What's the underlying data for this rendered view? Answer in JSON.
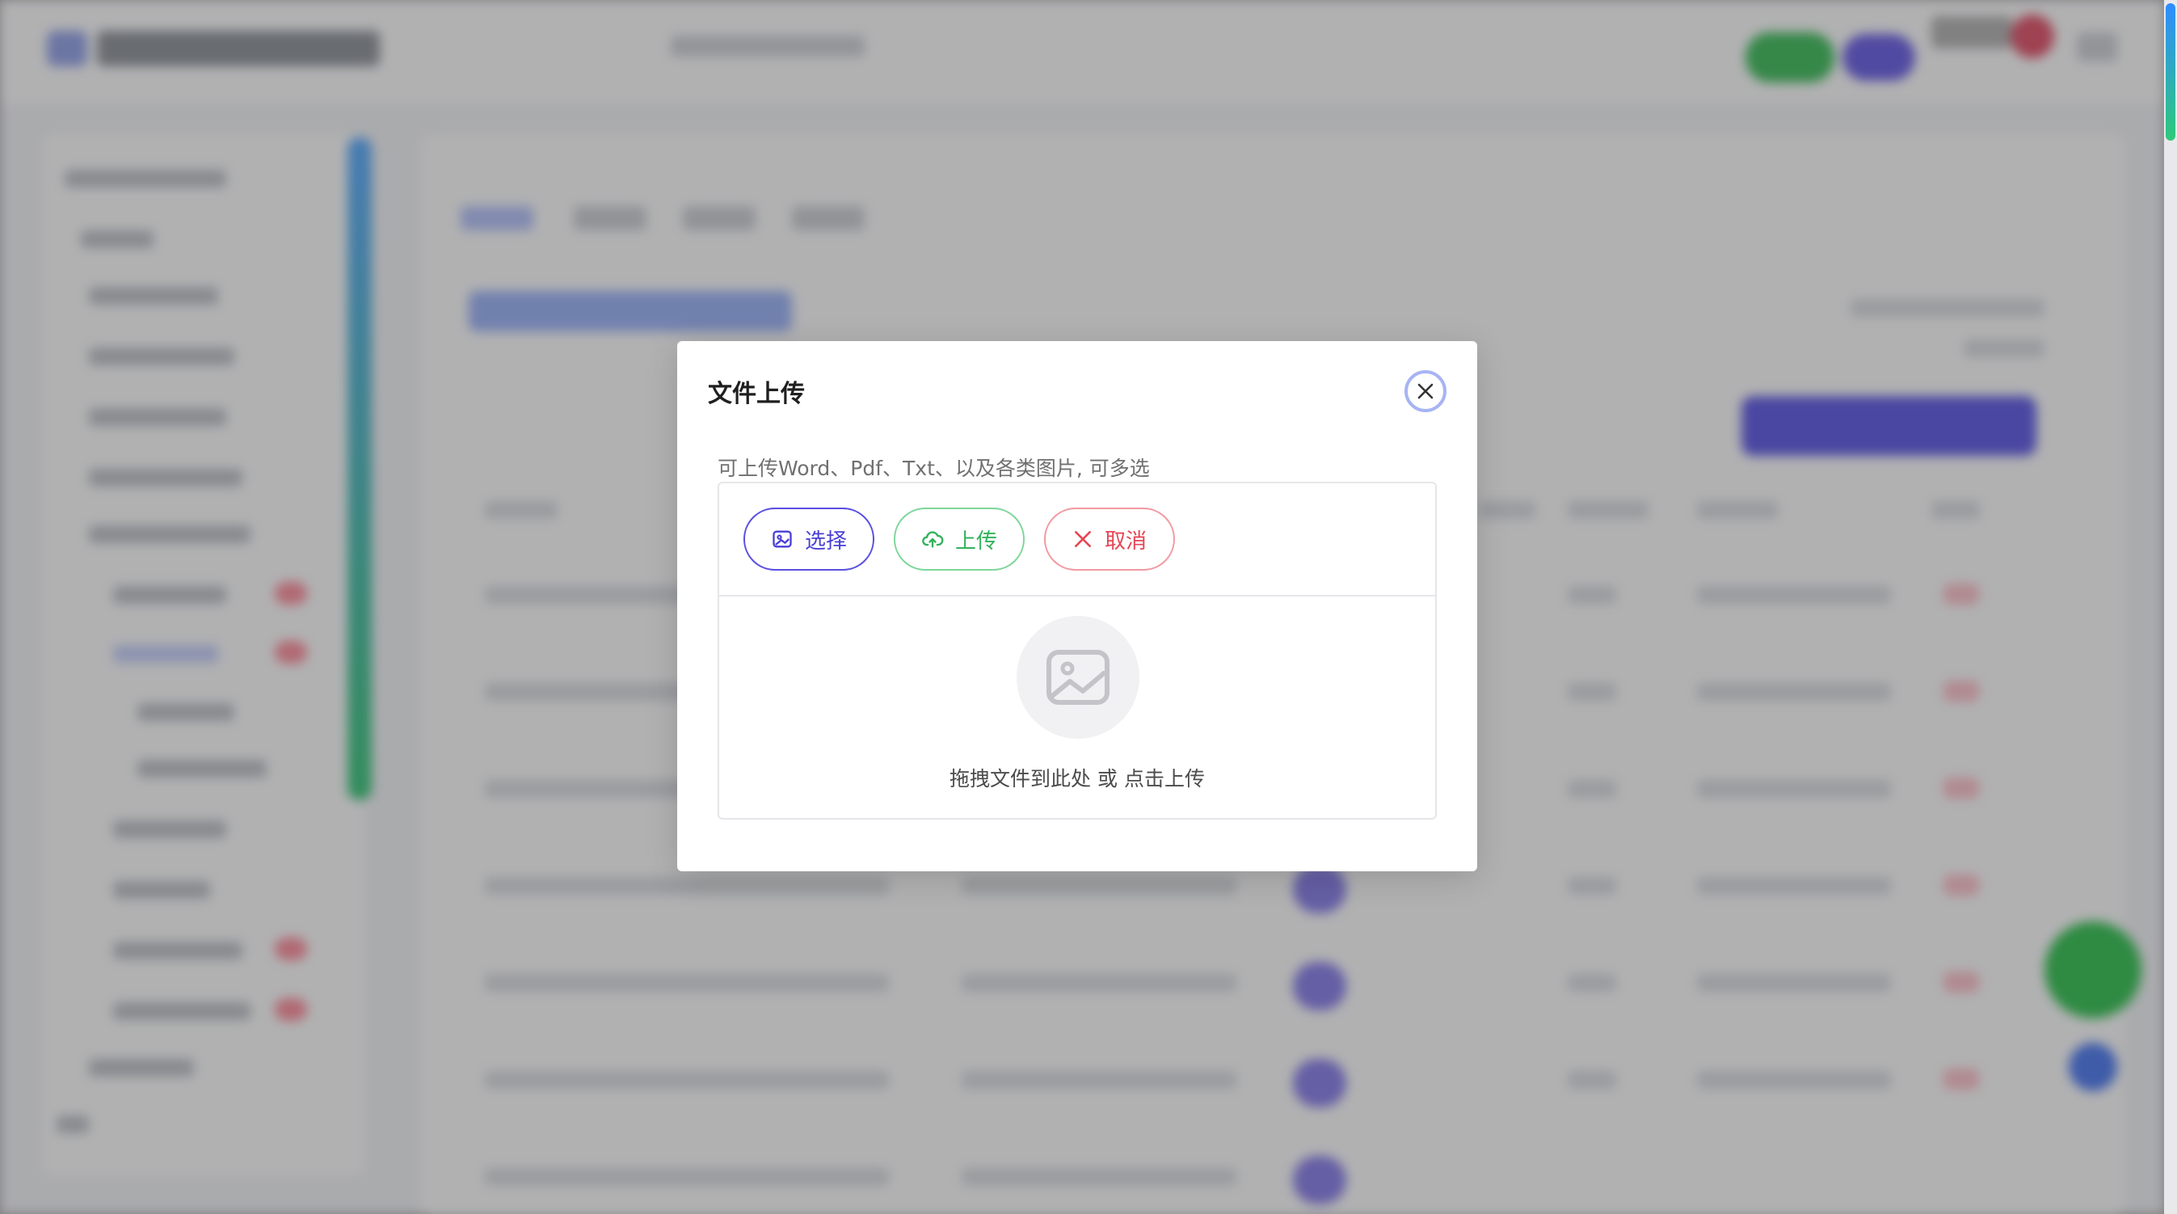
{
  "modal": {
    "title": "文件上传",
    "hint": "可上传Word、Pdf、Txt、以及各类图片, 可多选",
    "buttons": {
      "select": "选择",
      "upload": "上传",
      "cancel": "取消"
    },
    "drop_text": "拖拽文件到此处 或 点击上传"
  },
  "colors": {
    "select_accent": "#5a4fe0",
    "upload_accent": "#33b25c",
    "cancel_accent": "#e64555",
    "close_ring": "#a7b4f4"
  },
  "icons": {
    "close": "close-icon",
    "select": "image-icon",
    "upload": "cloud-upload-icon",
    "cancel": "x-icon",
    "placeholder": "image-placeholder-icon"
  }
}
